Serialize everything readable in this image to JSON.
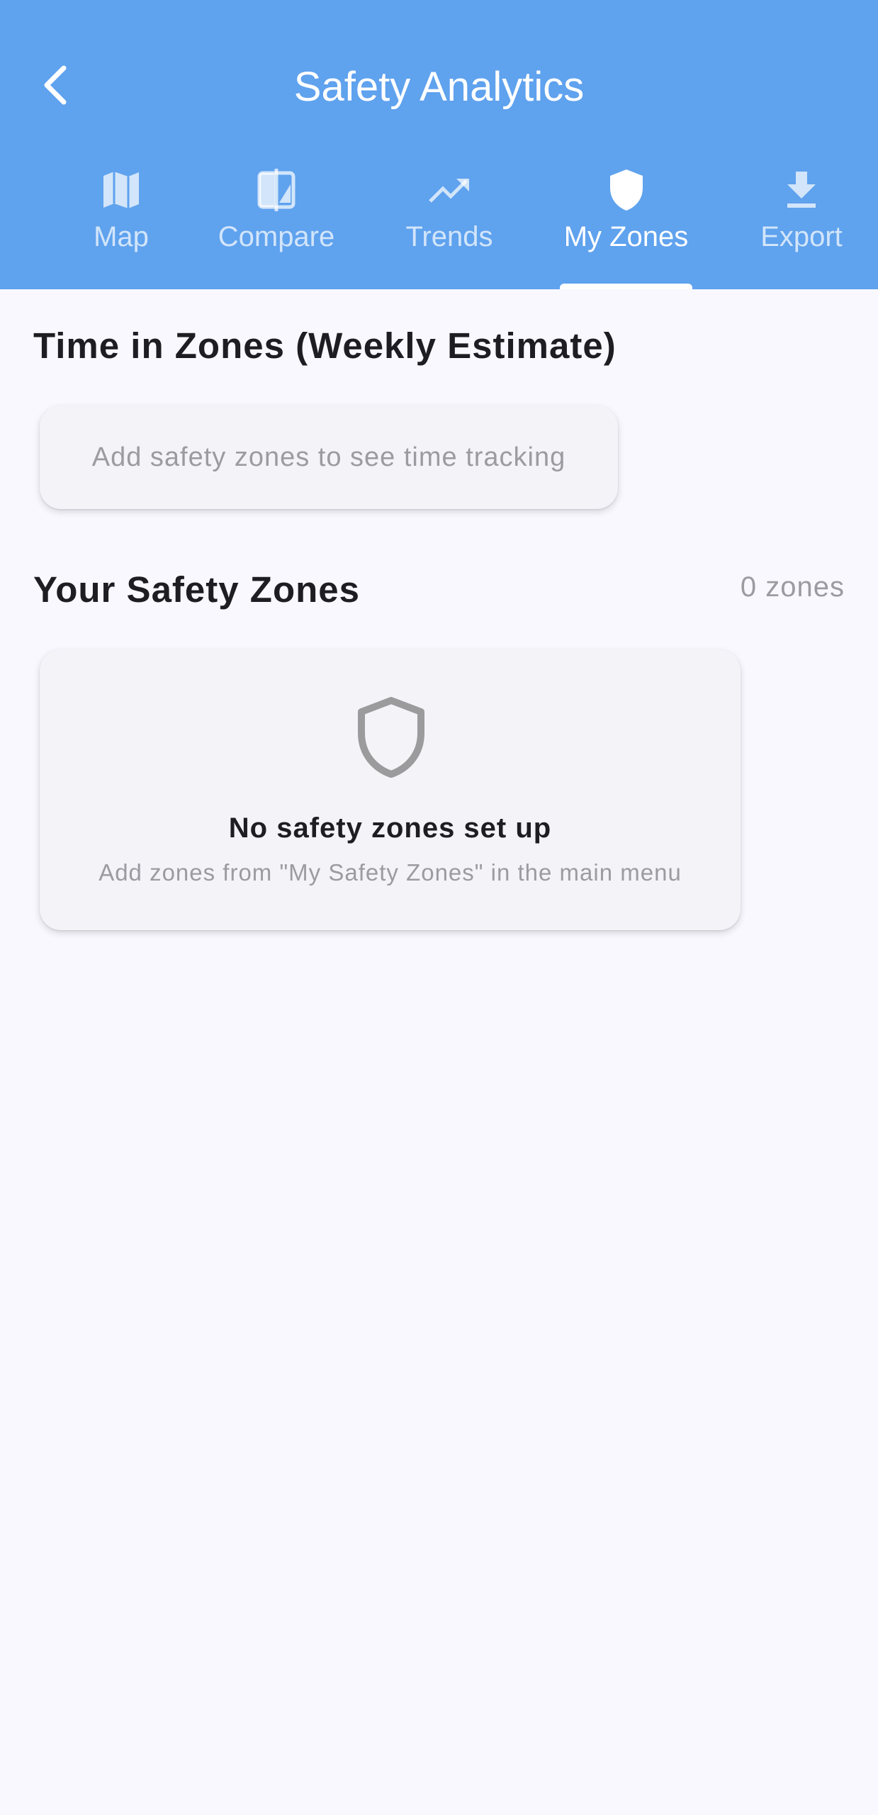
{
  "header": {
    "title": "Safety Analytics",
    "background_color": "#5FA2EE",
    "back_icon": "chevron-left-icon"
  },
  "tabs": [
    {
      "label": "Map",
      "icon": "map-icon",
      "active": false
    },
    {
      "label": "Compare",
      "icon": "compare-icon",
      "active": false
    },
    {
      "label": "Trends",
      "icon": "trending-up-icon",
      "active": false
    },
    {
      "label": "My Zones",
      "icon": "shield-icon",
      "active": true
    },
    {
      "label": "Export",
      "icon": "download-icon",
      "active": false
    }
  ],
  "time_in_zones": {
    "title": "Time in Zones (Weekly Estimate)",
    "placeholder": "Add safety zones to see time tracking"
  },
  "your_zones": {
    "title": "Your Safety Zones",
    "count_label": "0 zones",
    "empty_icon": "shield-outline-icon",
    "empty_title": "No safety zones set up",
    "empty_subtitle": "Add zones from \"My Safety Zones\" in the main menu"
  },
  "colors": {
    "accent": "#5FA2EE",
    "background": "#F8F8FE",
    "card": "#F3F3F8",
    "muted_text": "#9B9BA0"
  }
}
